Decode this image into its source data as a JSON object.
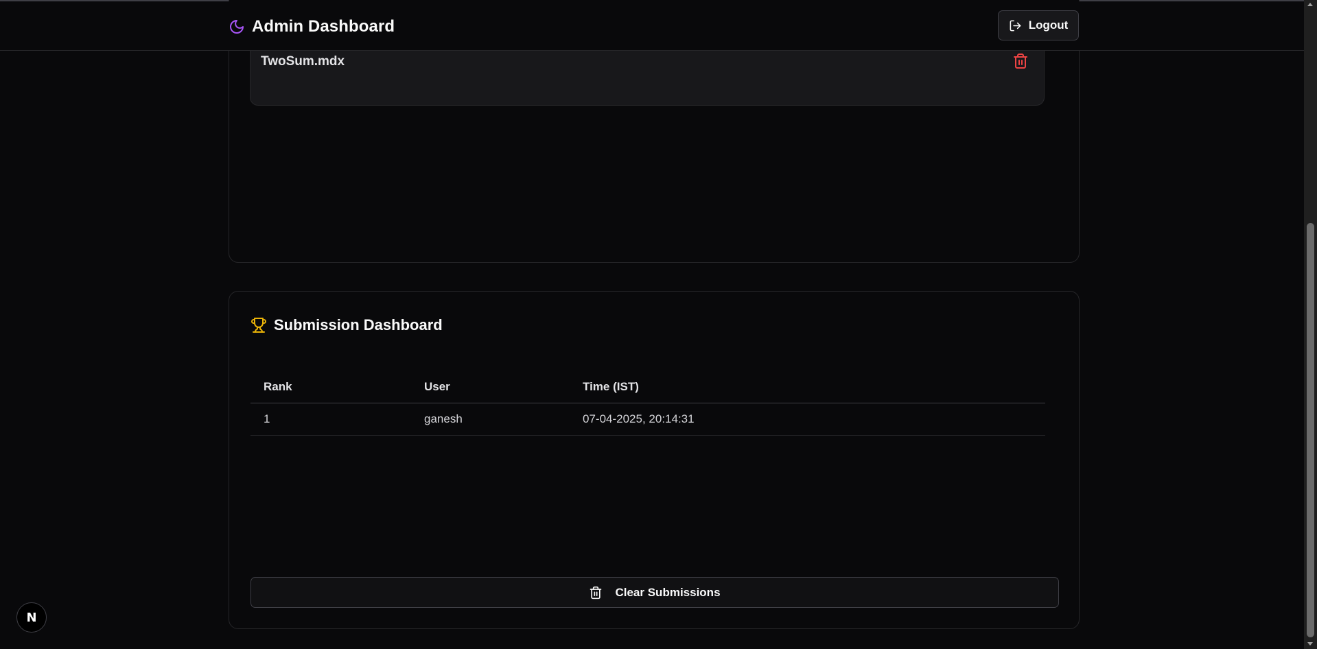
{
  "header": {
    "title": "Admin Dashboard",
    "logout_label": "Logout"
  },
  "files": {
    "items": [
      {
        "name": "TwoSum.mdx"
      }
    ]
  },
  "submissions": {
    "title": "Submission Dashboard",
    "columns": [
      "Rank",
      "User",
      "Time (IST)"
    ],
    "rows": [
      {
        "rank": "1",
        "user": "ganesh",
        "time": "07-04-2025, 20:14:31"
      }
    ],
    "clear_label": "Clear Submissions"
  },
  "badge": {
    "label": "N"
  },
  "colors": {
    "background": "#09090b",
    "accent_purple": "#a855f7",
    "trophy_yellow": "#eab308",
    "delete_red": "#ef4444"
  },
  "icons": {
    "brand": "moon-icon",
    "logout": "logout-icon",
    "file_delete": "trash-icon",
    "dashboard": "trophy-icon",
    "clear": "trash-icon"
  }
}
